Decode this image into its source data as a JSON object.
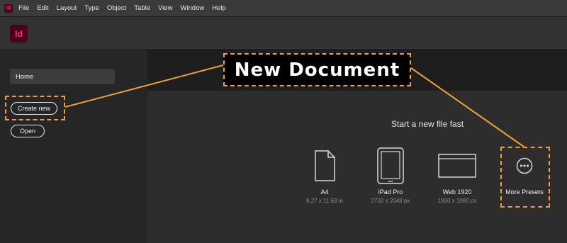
{
  "menubar": {
    "items": [
      "File",
      "Edit",
      "Layout",
      "Type",
      "Object",
      "Table",
      "View",
      "Window",
      "Help"
    ]
  },
  "app": {
    "logo_text": "Id",
    "accent": "#ff3366",
    "logo_bg": "#49021f"
  },
  "sidebar": {
    "home_label": "Home",
    "create_new_label": "Create new",
    "open_label": "Open"
  },
  "main": {
    "start_title": "Start a new file fast",
    "presets": [
      {
        "name": "A4",
        "dims": "8.27 x 11.69 in",
        "icon": "document-page-icon"
      },
      {
        "name": "iPad Pro",
        "dims": "2732 x 2048 px",
        "icon": "tablet-icon"
      },
      {
        "name": "Web 1920",
        "dims": "1920 x 1080 px",
        "icon": "web-browser-icon"
      },
      {
        "name": "More Presets",
        "dims": "",
        "icon": "more-options-icon"
      }
    ]
  },
  "annotation": {
    "callout_text": "New Document",
    "highlight_color": "#f0a030"
  }
}
